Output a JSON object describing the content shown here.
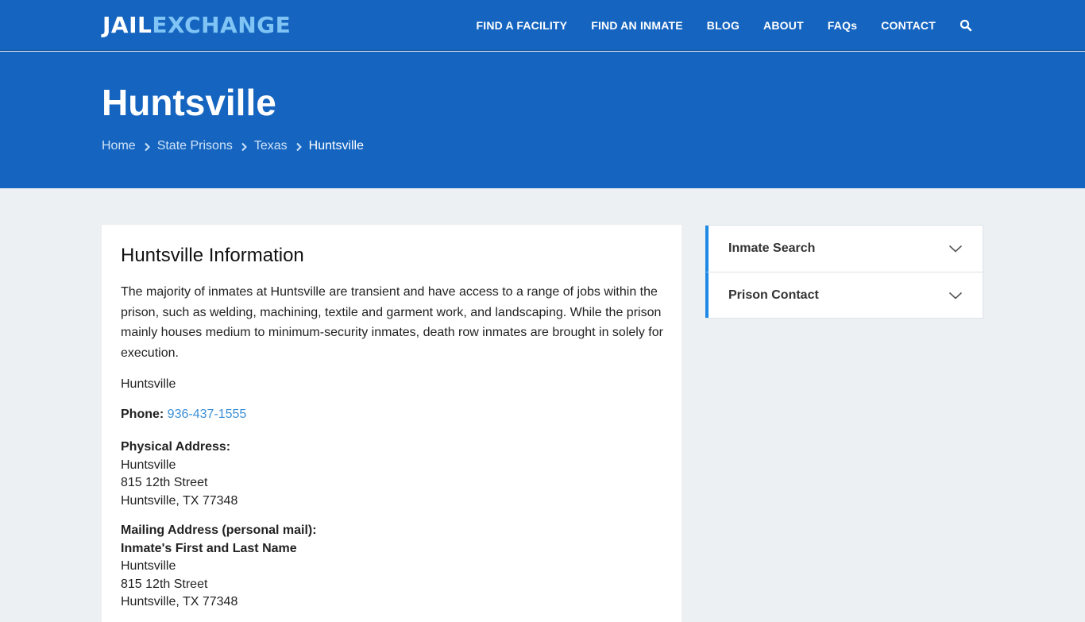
{
  "header": {
    "logo_part1": "JAIL",
    "logo_part2": "EXCHANGE",
    "nav": [
      "FIND A FACILITY",
      "FIND AN INMATE",
      "BLOG",
      "ABOUT",
      "FAQs",
      "CONTACT"
    ],
    "search_icon": "search-icon"
  },
  "hero": {
    "title": "Huntsville",
    "breadcrumbs": [
      "Home",
      "State Prisons",
      "Texas"
    ],
    "current": "Huntsville"
  },
  "content": {
    "heading": "Huntsville Information",
    "description": "The majority of inmates at Huntsville are transient and have access to a range of jobs within the prison, such as welding, machining, textile and garment work, and landscaping. While the prison mainly houses medium to minimum-security inmates, death row inmates are brought in solely for execution.",
    "name": "Huntsville",
    "phone_label": "Phone:",
    "phone_value": "936-437-1555",
    "physical": {
      "label": "Physical Address:",
      "lines": [
        "Huntsville",
        "815 12th Street",
        "Huntsville, TX 77348"
      ]
    },
    "mailing": {
      "label": "Mailing Address (personal mail):",
      "recipient": "Inmate's First and Last Name",
      "lines": [
        "Huntsville",
        "815 12th Street",
        "Huntsville, TX 77348"
      ]
    }
  },
  "sidebar": {
    "items": [
      "Inmate Search",
      "Prison Contact"
    ]
  },
  "colors": {
    "brand_blue": "#1565c0",
    "logo_accent": "#7fc4f5",
    "link": "#3a8fd6",
    "sidebar_accent": "#1e88e5",
    "page_bg": "#ecf0f3"
  }
}
